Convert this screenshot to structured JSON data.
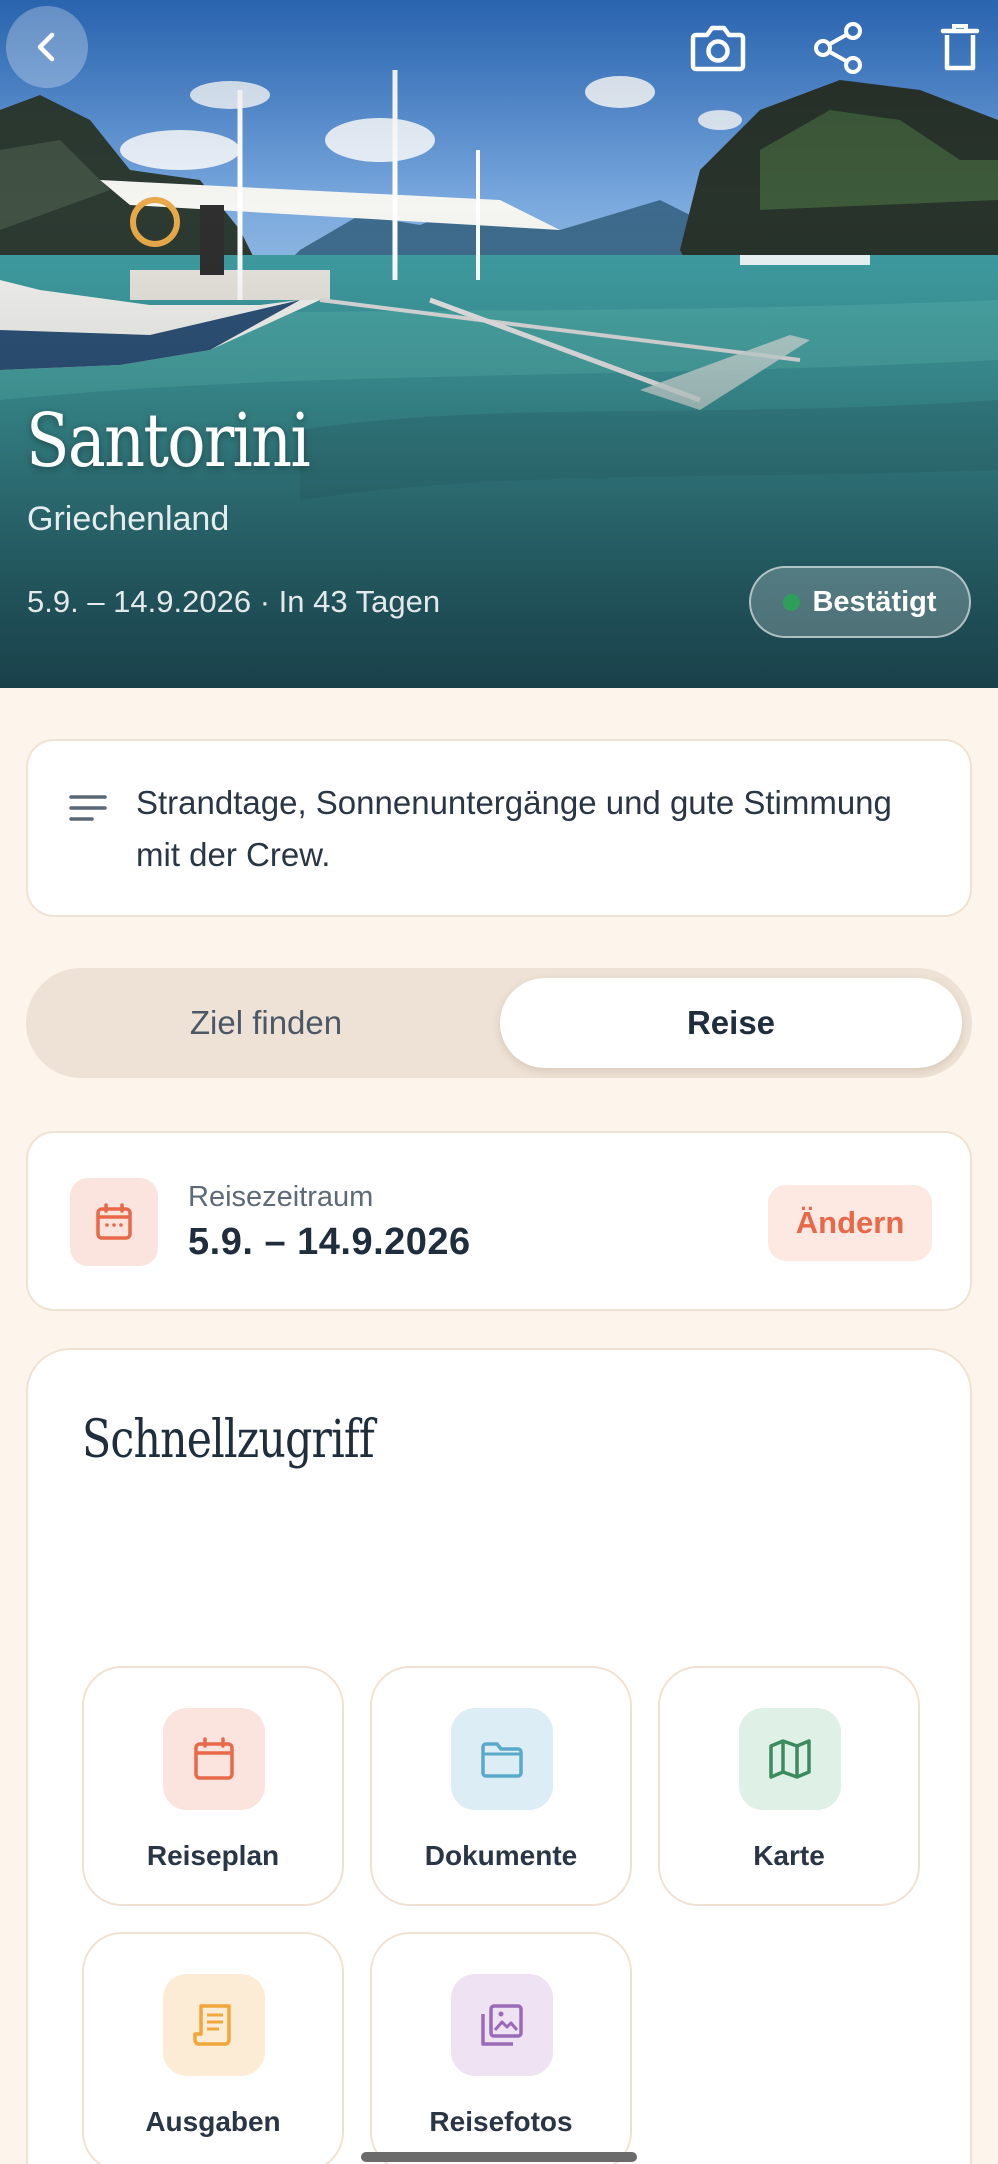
{
  "header": {
    "title": "Santorini",
    "country": "Griechenland",
    "dates": "5.9. – 14.9.2026 · In 43 Tagen",
    "status": {
      "label": "Bestätigt",
      "color": "#2e9e5b"
    },
    "actions": [
      "back-icon",
      "camera-icon",
      "share-icon",
      "trash-icon"
    ]
  },
  "note": {
    "text": "Strandtage, Sonnenuntergänge und gute Stimmung mit der Crew."
  },
  "tabs": [
    {
      "label": "Ziel finden",
      "active": false
    },
    {
      "label": "Reise",
      "active": true
    }
  ],
  "period": {
    "label": "Reisezeitraum",
    "value": "5.9. – 14.9.2026",
    "change_label": "Ändern"
  },
  "quick_access": {
    "title": "Schnellzugriff",
    "items": [
      {
        "label": "Reiseplan",
        "icon": "calendar-icon",
        "color": "#e8694a",
        "bg": "#fbe4dd"
      },
      {
        "label": "Dokumente",
        "icon": "folder-icon",
        "color": "#5aa9c9",
        "bg": "#dcedf5"
      },
      {
        "label": "Karte",
        "icon": "map-icon",
        "color": "#3c8a5f",
        "bg": "#dff1e6"
      },
      {
        "label": "Ausgaben",
        "icon": "receipt-icon",
        "color": "#f0a83c",
        "bg": "#fdecd5"
      },
      {
        "label": "Reisefotos",
        "icon": "photos-icon",
        "color": "#9a6ab8",
        "bg": "#efe2f3"
      }
    ]
  }
}
